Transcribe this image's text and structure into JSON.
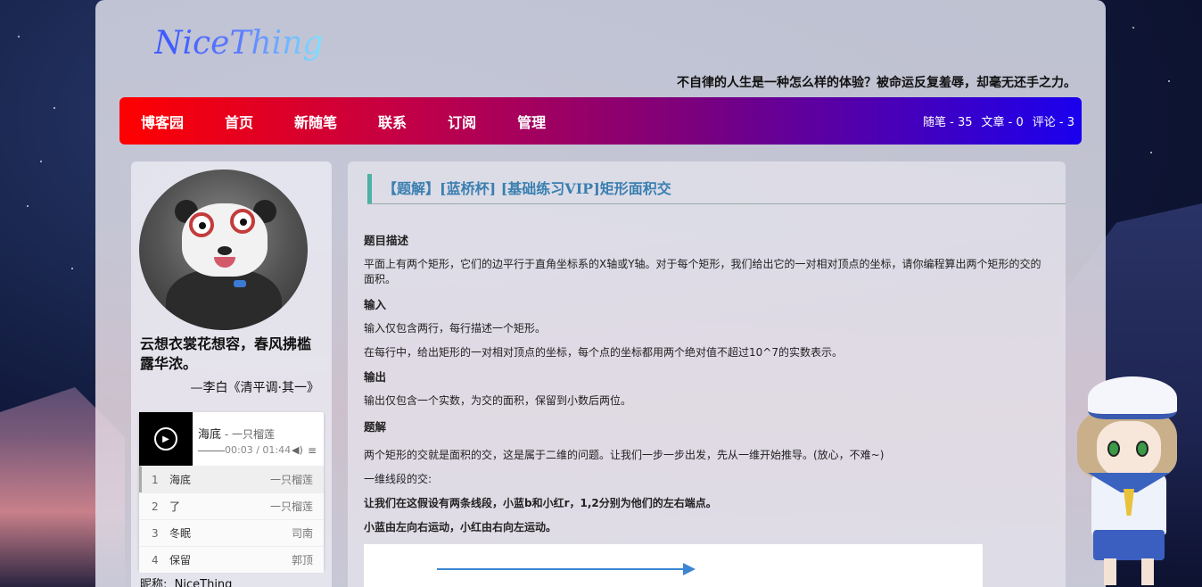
{
  "site": {
    "logo_text": "NiceThing",
    "motto": "不自律的人生是一种怎么样的体验？被命运反复羞辱，却毫无还手之力。"
  },
  "nav": {
    "items": [
      {
        "label": "博客园"
      },
      {
        "label": "首页"
      },
      {
        "label": "新随笔"
      },
      {
        "label": "联系"
      },
      {
        "label": "订阅"
      },
      {
        "label": "管理"
      }
    ],
    "stats": {
      "posts": "随笔 - 35",
      "articles": "文章 - 0",
      "comments": "评论 - 3"
    }
  },
  "sidebar": {
    "quote": "云想衣裳花想容，春风拂槛露华浓。",
    "quote_author": "—李白《清平调·其一》",
    "nickname_label": "昵称:",
    "nickname_value": "NiceThing",
    "player": {
      "song": "海底",
      "artist": " - 一只榴莲",
      "time": "00:03 / 01:44",
      "playlist": [
        {
          "num": "1",
          "name": "海底",
          "artist": "一只榴莲"
        },
        {
          "num": "2",
          "name": "了",
          "artist": "一只榴莲"
        },
        {
          "num": "3",
          "name": "冬眠",
          "artist": "司南"
        },
        {
          "num": "4",
          "name": "保留",
          "artist": "郭顶"
        }
      ]
    }
  },
  "post": {
    "title": "【题解】[蓝桥杯] [基础练习VIP]矩形面积交",
    "h_desc": "题目描述",
    "p_desc": "平面上有两个矩形，它们的边平行于直角坐标系的X轴或Y轴。对于每个矩形，我们给出它的一对相对顶点的坐标，请你编程算出两个矩形的交的面积。",
    "h_input": "输入",
    "p_input1": "输入仅包含两行，每行描述一个矩形。",
    "p_input2": "在每行中，给出矩形的一对相对顶点的坐标，每个点的坐标都用两个绝对值不超过10^7的实数表示。",
    "h_output": "输出",
    "p_output": "输出仅包含一个实数，为交的面积，保留到小数后两位。",
    "h_solution": "题解",
    "p_solution": "两个矩形的交就是面积的交，这是属于二维的问题。让我们一步一步出发，先从一维开始推导。(放心，不难~)",
    "p_1d": "一维线段的交:",
    "p_bold1": "让我们在这假设有两条线段，小蓝b和小红r，1,2分别为他们的左右端点。",
    "p_bold2": "小蓝由左向右运动，小红由右向左运动。"
  }
}
